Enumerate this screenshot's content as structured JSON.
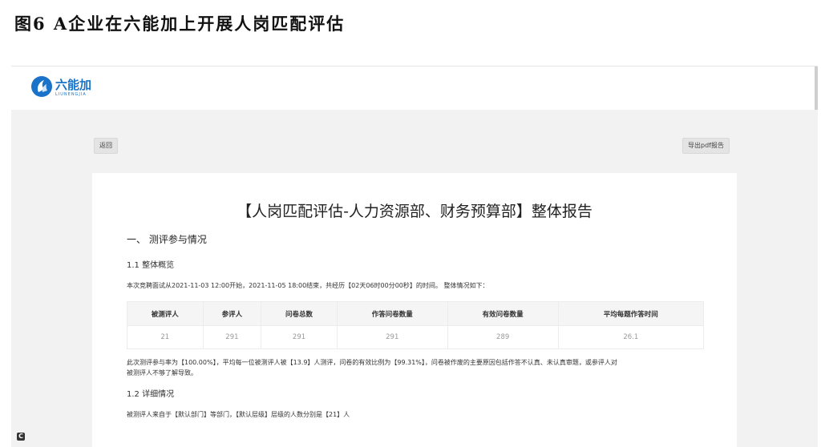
{
  "caption": "图6 A企业在六能加上开展人岗匹配评估",
  "app": {
    "logo_text": "六能加",
    "logo_sub": "LIUNENGJIA",
    "back_label": "返回",
    "export_label": "导出pdf报告"
  },
  "report": {
    "title": "【人岗匹配评估-人力资源部、财务预算部】整体报告",
    "section1": "一、 测评参与情况",
    "sub1": "1.1 整体概览",
    "intro": "本次竞聘面试从2021-11-03 12:00开始，2021-11-05 18:00结束，共经历【02天06时00分00秒】的时间。 整体情况如下：",
    "table": {
      "headers": [
        "被测评人",
        "参评人",
        "问卷总数",
        "作答问卷数量",
        "有效问卷数量",
        "平均每题作答时间"
      ],
      "row": [
        "21",
        "291",
        "291",
        "291",
        "289",
        "26.1"
      ]
    },
    "summary_line1": "此次测评参与率为【100.00%】，平均每一位被测评人被【13.9】人测评，问卷的有效比例为【99.31%】，问卷被作废的主要原因包括作答不认真、未认真审题，或参评人对",
    "summary_line2": "被测评人不够了解导致。",
    "sub2": "1.2 详细情况",
    "detail": "被测评人来自于【默认部门】等部门，【默认层级】层级的人数分别是【21】人"
  },
  "corner_icon_label": "C"
}
